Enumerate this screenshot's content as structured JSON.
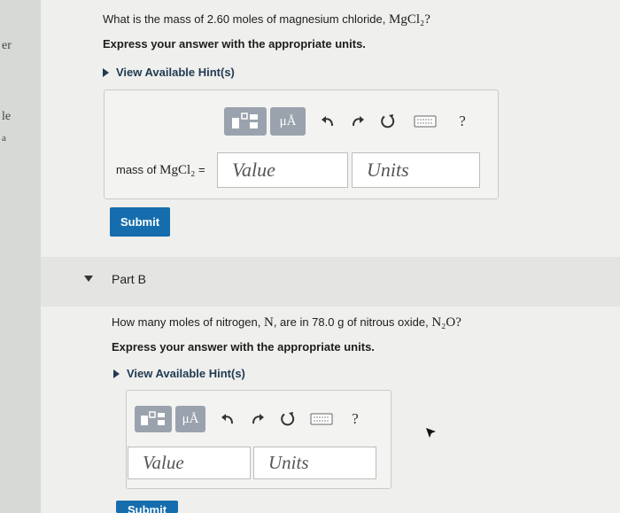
{
  "left_fragments": [
    "er",
    "le",
    "a"
  ],
  "part_a": {
    "question_prefix": "What is the mass of 2.60 moles of magnesium chloride,",
    "question_formula": "MgCl₂",
    "question_suffix": "?",
    "instruction": "Express your answer with the appropriate units.",
    "hint_link": "View Available Hint(s)",
    "answer_label_prefix": "mass of",
    "answer_label_formula": "MgCl₂",
    "answer_label_eq": "=",
    "value_placeholder": "Value",
    "units_placeholder": "Units",
    "submit_label": "Submit"
  },
  "toolbar": {
    "templates_icon": "templates-icon",
    "units_button": "μÅ",
    "undo_icon": "undo-icon",
    "redo_icon": "redo-icon",
    "reset_icon": "reset-icon",
    "keyboard_icon": "keyboard-icon",
    "help_label": "?"
  },
  "part_b": {
    "title": "Part B",
    "question_prefix": "How many moles of nitrogen,",
    "question_n": "N",
    "question_mid": ", are in 78.0 g of nitrous oxide,",
    "question_formula": "N₂O",
    "question_suffix": "?",
    "instruction": "Express your answer with the appropriate units.",
    "hint_link": "View Available Hint(s)",
    "value_placeholder": "Value",
    "units_placeholder": "Units",
    "submit_label": "Submit"
  },
  "colors": {
    "submit_bg": "#166dad",
    "hint_text": "#1f3a52",
    "toolbar_button": "#9aa3ad"
  }
}
